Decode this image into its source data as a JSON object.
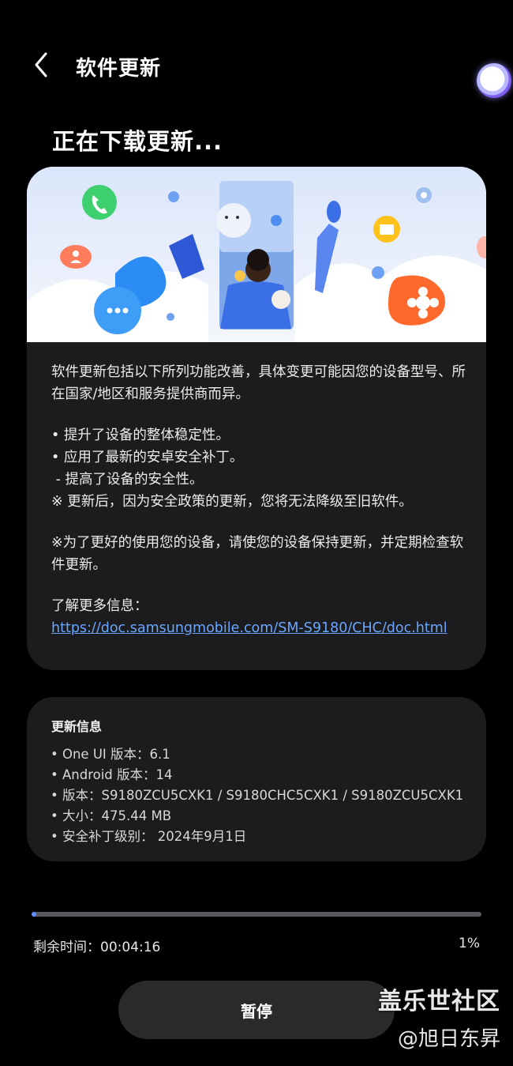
{
  "header": {
    "title": "软件更新"
  },
  "page": {
    "title": "正在下载更新..."
  },
  "notes": {
    "intro": "软件更新包括以下所列功能改善，具体变更可能因您的设备型号、所在国家/地区和服务提供商而异。",
    "items": [
      "• 提升了设备的整体稳定性。",
      "• 应用了最新的安卓安全补丁。",
      " - 提高了设备的安全性。",
      "※ 更新后，因为安全政策的更新，您将无法降级至旧软件。"
    ],
    "advice": "※为了更好的使用您的设备，请使您的设备保持更新，并定期检查软件更新。",
    "more_label": "了解更多信息：",
    "link": "https://doc.samsungmobile.com/SM-S9180/CHC/doc.html"
  },
  "info": {
    "title": "更新信息",
    "items": [
      "• One UI 版本：6.1",
      "• Android 版本：14",
      "• 版本：S9180ZCU5CXK1 / S9180CHC5CXK1 / S9180ZCU5CXK1",
      "• 大小：475.44 MB",
      "• 安全补丁级别： 2024年9月1日"
    ]
  },
  "progress": {
    "fraction": 0.01,
    "remaining": "剩余时间：00:04:16",
    "percent": "1%"
  },
  "buttons": {
    "pause": "暂停"
  },
  "watermark": {
    "main": "盖乐世社区",
    "sub": "@旭日东昇"
  },
  "colors": {
    "accent": "#5b8dff",
    "link": "#6aa6ff",
    "card": "#1c1c1e"
  },
  "icons": [
    "back-chevron-icon",
    "phone-icon",
    "chat-icon",
    "folder-icon",
    "flower-icon",
    "settings-icon",
    "person-icon"
  ]
}
